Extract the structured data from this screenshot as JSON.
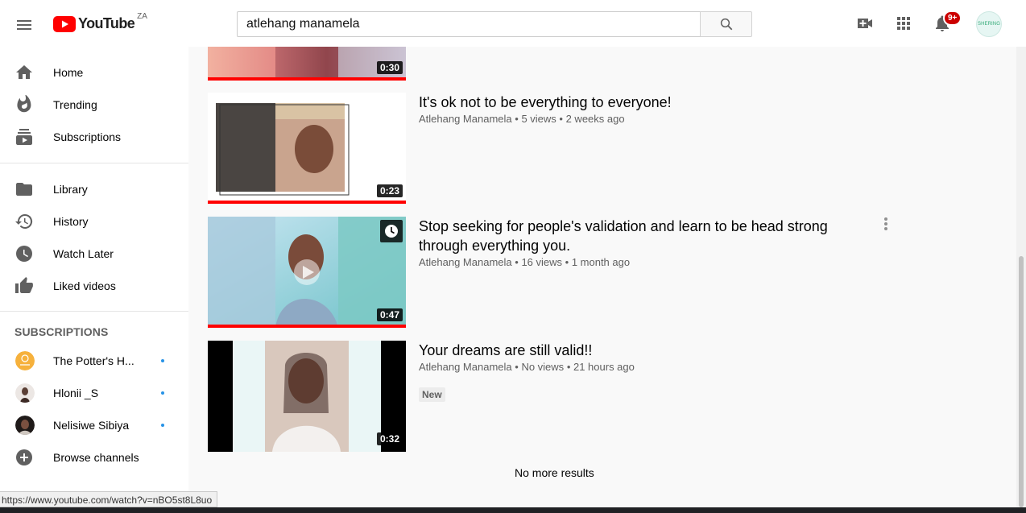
{
  "header": {
    "logo_text": "YouTube",
    "country": "ZA",
    "search_value": "atlehang manamela",
    "notification_count": "9+",
    "avatar_text": "SHERING"
  },
  "sidebar": {
    "main": [
      {
        "label": "Home",
        "icon": "home-icon"
      },
      {
        "label": "Trending",
        "icon": "fire-icon"
      },
      {
        "label": "Subscriptions",
        "icon": "subscriptions-icon"
      }
    ],
    "library": [
      {
        "label": "Library",
        "icon": "folder-icon"
      },
      {
        "label": "History",
        "icon": "history-icon"
      },
      {
        "label": "Watch Later",
        "icon": "clock-icon"
      },
      {
        "label": "Liked videos",
        "icon": "thumbs-up-icon"
      }
    ],
    "subscriptions_heading": "SUBSCRIPTIONS",
    "subscriptions": [
      {
        "label": "The Potter's H..."
      },
      {
        "label": "Hlonii _S"
      },
      {
        "label": "Nelisiwe Sibiya"
      }
    ],
    "browse_label": "Browse channels"
  },
  "results": [
    {
      "duration": "0:30"
    },
    {
      "title": "It's ok not to be everything to everyone!",
      "channel": "Atlehang Manamela",
      "views": "5 views",
      "age": "2 weeks ago",
      "duration": "0:23"
    },
    {
      "title": "Stop seeking for people's validation and learn to be head strong through everything you.",
      "channel": "Atlehang Manamela",
      "views": "16 views",
      "age": "1 month ago",
      "duration": "0:47"
    },
    {
      "title": "Your dreams are still valid!!",
      "channel": "Atlehang Manamela",
      "views": "No views",
      "age": "21 hours ago",
      "duration": "0:32",
      "badge": "New"
    }
  ],
  "no_more_results": "No more results",
  "status_url": "https://www.youtube.com/watch?v=nBO5st8L8uo",
  "colors": {
    "accent": "#ff0000",
    "text_secondary": "#606060"
  }
}
